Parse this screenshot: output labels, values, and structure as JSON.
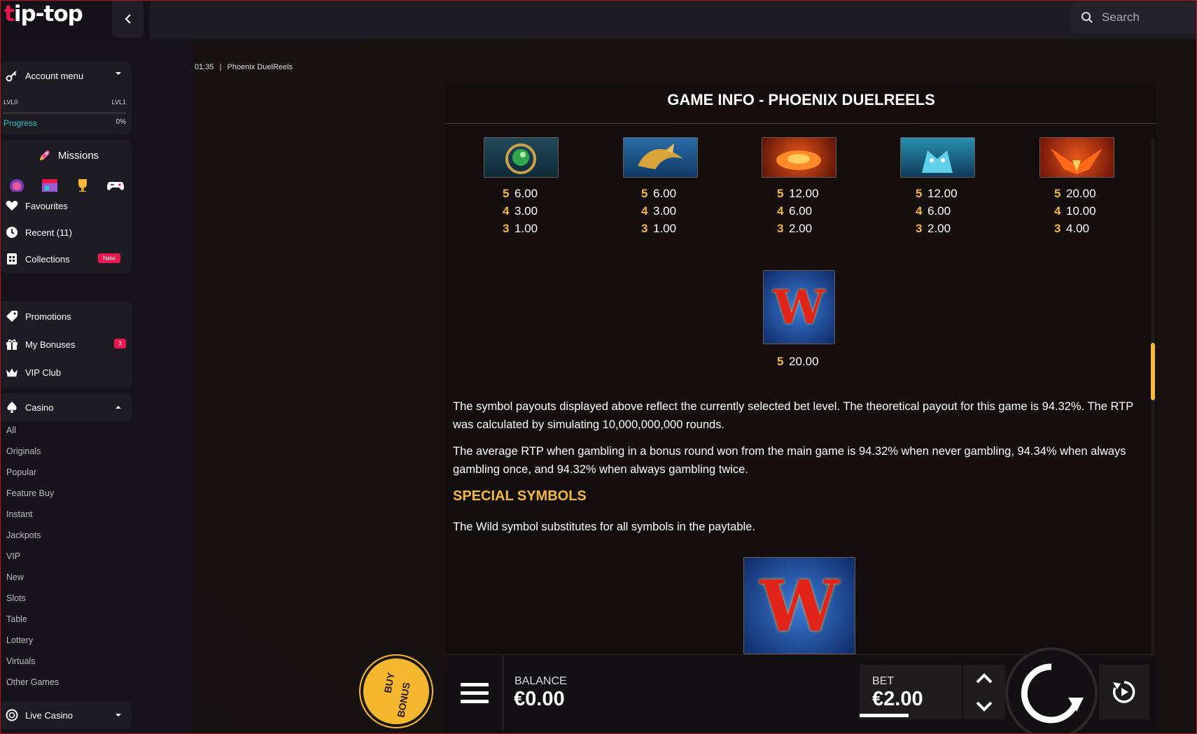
{
  "app": {
    "logo_first": "t",
    "logo_rest": "ip-top"
  },
  "search": {
    "placeholder": "Search"
  },
  "sidebar": {
    "account_menu": "Account menu",
    "lvl_left": "LVL0",
    "lvl_right": "LVL1",
    "progress_label": "Progress",
    "progress_value": "0%",
    "missions": "Missions",
    "favourites": "Favourites",
    "recent": "Recent (11)",
    "collections": "Collections",
    "collections_badge": "New",
    "promotions": "Promotions",
    "my_bonuses": "My Bonuses",
    "my_bonuses_badge": "3",
    "vip_club": "VIP Club",
    "casino": "Casino",
    "casino_items": [
      "All",
      "Originals",
      "Popular",
      "Feature Buy",
      "Instant",
      "Jackpots",
      "VIP",
      "New",
      "Slots",
      "Table",
      "Lottery",
      "Virtuals",
      "Other Games"
    ],
    "live_casino": "Live Casino",
    "colors": {
      "accent": "#e8184f",
      "progress": "#2ec8c8"
    }
  },
  "game": {
    "time": "01:35",
    "separator": "|",
    "name": "Phoenix DuelReels",
    "panel_title": "GAME INFO - PHOENIX DUELREELS",
    "paytable": [
      {
        "symbol": "green-eye-amulet",
        "lines": [
          {
            "n": "5",
            "v": "6.00"
          },
          {
            "n": "4",
            "v": "3.00"
          },
          {
            "n": "3",
            "v": "1.00"
          }
        ]
      },
      {
        "symbol": "golden-dragon-blue",
        "lines": [
          {
            "n": "5",
            "v": "6.00"
          },
          {
            "n": "4",
            "v": "3.00"
          },
          {
            "n": "3",
            "v": "1.00"
          }
        ]
      },
      {
        "symbol": "fire-lava",
        "lines": [
          {
            "n": "5",
            "v": "12.00"
          },
          {
            "n": "4",
            "v": "6.00"
          },
          {
            "n": "3",
            "v": "2.00"
          }
        ]
      },
      {
        "symbol": "blue-ice-dragon",
        "lines": [
          {
            "n": "5",
            "v": "12.00"
          },
          {
            "n": "4",
            "v": "6.00"
          },
          {
            "n": "3",
            "v": "2.00"
          }
        ]
      },
      {
        "symbol": "red-phoenix",
        "lines": [
          {
            "n": "5",
            "v": "20.00"
          },
          {
            "n": "4",
            "v": "10.00"
          },
          {
            "n": "3",
            "v": "4.00"
          }
        ]
      }
    ],
    "wild_pay": {
      "n": "5",
      "v": "20.00"
    },
    "para1": "The symbol payouts displayed above reflect the currently selected bet level. The theoretical payout for this game is 94.32%. The RTP was calculated by simulating 10,000,000,000 rounds.",
    "para2": "The average RTP when gambling in a bonus round won from the main game is 94.32% when never gambling, 94.34% when always gambling once, and 94.32% when always gambling twice.",
    "special_title": "SPECIAL SYMBOLS",
    "special_text": "The Wild symbol substitutes for all symbols in the paytable.",
    "wild_letter": "W"
  },
  "controls": {
    "buy_bonus_line1": "BUY",
    "buy_bonus_line2": "BONUS",
    "balance_label": "BALANCE",
    "balance_value": "€0.00",
    "bet_label": "BET",
    "bet_value": "€2.00",
    "colors": {
      "gold": "#f2b93b"
    }
  }
}
